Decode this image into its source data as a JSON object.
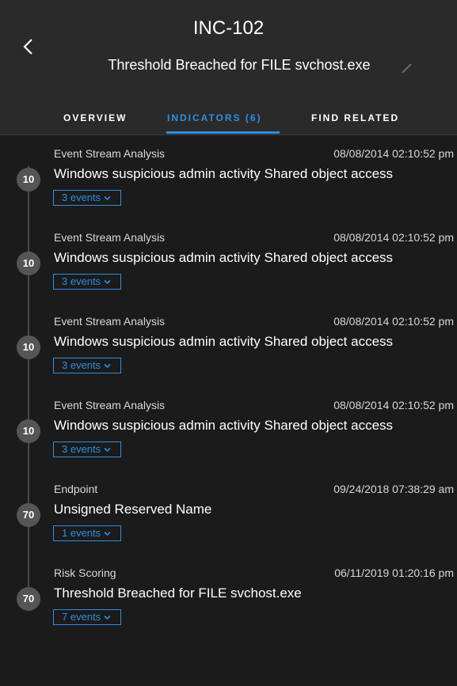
{
  "header": {
    "incident_id": "INC-102",
    "title": "Threshold Breached for FILE svchost.exe"
  },
  "tabs": [
    {
      "label": "OVERVIEW",
      "active": false
    },
    {
      "label": "INDICATORS (6)",
      "active": true
    },
    {
      "label": "FIND RELATED",
      "active": false
    }
  ],
  "indicators": [
    {
      "score": "10",
      "source": "Event Stream Analysis",
      "timestamp": "08/08/2014 02:10:52 pm",
      "name": "Windows suspicious admin activity Shared object access",
      "events_label": "3 events"
    },
    {
      "score": "10",
      "source": "Event Stream Analysis",
      "timestamp": "08/08/2014 02:10:52 pm",
      "name": "Windows suspicious admin activity Shared object access",
      "events_label": "3 events"
    },
    {
      "score": "10",
      "source": "Event Stream Analysis",
      "timestamp": "08/08/2014 02:10:52 pm",
      "name": "Windows suspicious admin activity Shared object access",
      "events_label": "3 events"
    },
    {
      "score": "10",
      "source": "Event Stream Analysis",
      "timestamp": "08/08/2014 02:10:52 pm",
      "name": "Windows suspicious admin activity Shared object access",
      "events_label": "3 events"
    },
    {
      "score": "70",
      "source": "Endpoint",
      "timestamp": "09/24/2018 07:38:29 am",
      "name": "Unsigned Reserved Name",
      "events_label": "1 events"
    },
    {
      "score": "70",
      "source": "Risk Scoring",
      "timestamp": "06/11/2019 01:20:16 pm",
      "name": "Threshold Breached for FILE svchost.exe",
      "events_label": "7 events"
    }
  ],
  "colors": {
    "accent": "#2f8ddf",
    "background": "#1b1b1b",
    "header_background": "#2a2a2a",
    "badge": "#555555"
  },
  "icons": {
    "back": "chevron-left-icon",
    "edit": "pencil-icon",
    "events_toggle": "chevron-down-icon"
  }
}
